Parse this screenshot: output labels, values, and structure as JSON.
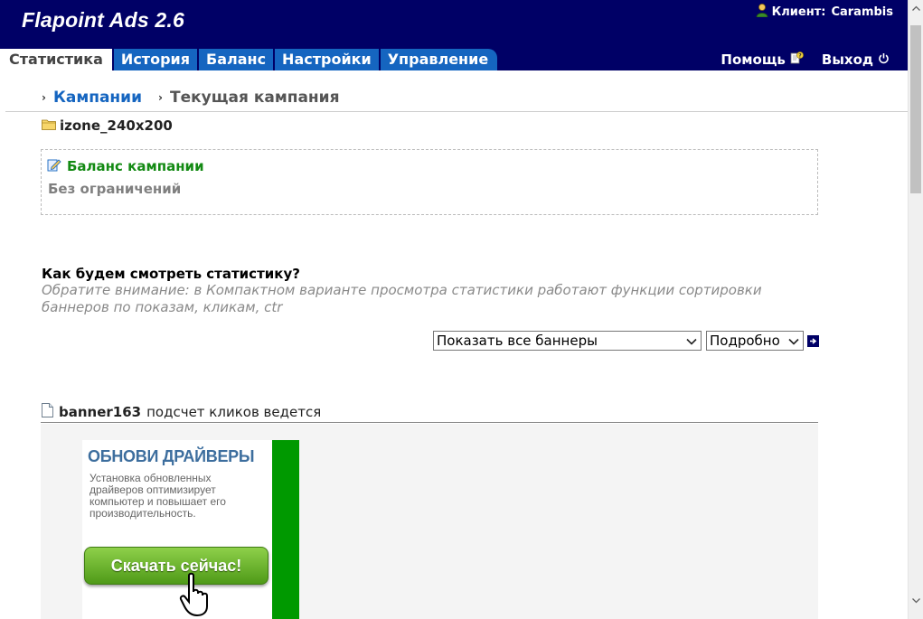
{
  "app": {
    "title": "Flapoint Ads 2.6"
  },
  "client": {
    "label": "Клиент:",
    "name": "Carambis"
  },
  "tabs": [
    "Статистика",
    "История",
    "Баланс",
    "Настройки",
    "Управление"
  ],
  "header_links": {
    "help": "Помощь",
    "logout": "Выход"
  },
  "breadcrumb": {
    "link": "Кампании",
    "current": "Текущая кампания"
  },
  "zone": {
    "name": "izone_240x200"
  },
  "balance": {
    "title": "Баланс кампании",
    "value": "Без ограничений"
  },
  "stats": {
    "question": "Как будем смотреть статистику?",
    "note": "Обратите внимание: в Компактном варианте просмотра статистики работают функции сортировки баннеров по показам, кликам, ctr",
    "filter_selected": "Показать все баннеры",
    "mode_selected": "Подробно"
  },
  "banner": {
    "name": "banner163",
    "status": "подсчет кликов ведется",
    "ad": {
      "title": "ОБНОВИ ДРАЙВЕРЫ",
      "text": "Установка обновленных драйверов оптимизирует компьютер и повышает его производительность.",
      "button": "Скачать сейчас!"
    }
  },
  "colors": {
    "header_bg": "#000066",
    "tab_bg": "#1565c0",
    "link": "#1565c0",
    "balance_title": "#138a13",
    "ad_stripe": "#009900"
  },
  "icons": [
    "user-icon",
    "help-icon",
    "power-icon",
    "folder-icon",
    "edit-icon",
    "file-icon",
    "go-arrow-icon"
  ]
}
